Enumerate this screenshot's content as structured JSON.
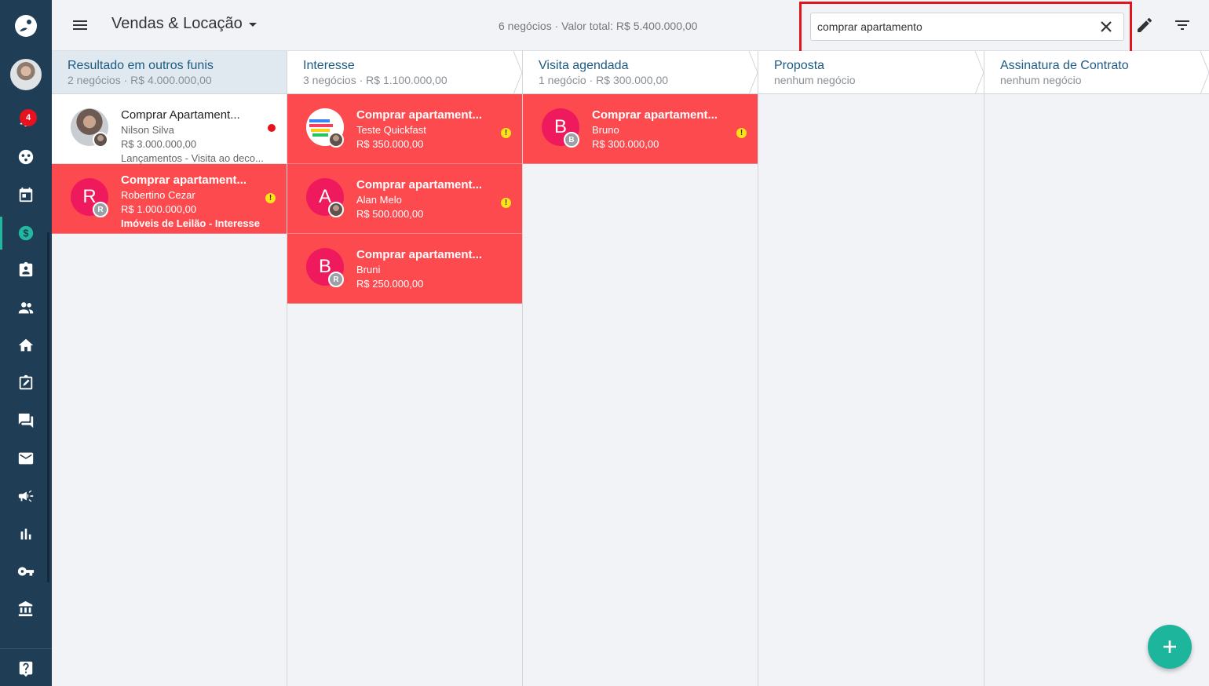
{
  "app": {
    "sidebar_badge": "4"
  },
  "header": {
    "funnel_name": "Vendas & Locação",
    "summary": "6 negócios · Valor total: R$ 5.400.000,00",
    "search_value": "comprar apartamento"
  },
  "colors": {
    "sidebar": "#1f3e55",
    "card_alert": "#fc4a4f",
    "accent": "#1db59b",
    "column_title": "#1d5a82",
    "highlight": "#e2161d"
  },
  "columns": [
    {
      "title": "Resultado em outros funis",
      "sub": "2 negócios · R$ 4.000.000,00",
      "cards": [
        {
          "title": "Comprar Apartament...",
          "person": "Nilson Silva",
          "value": "R$ 3.000.000,00",
          "extra": "Lançamentos - Visita ao deco...",
          "avatar": "",
          "style": "white"
        },
        {
          "title": "Comprar apartament...",
          "person": "Robertino Cezar",
          "value": "R$ 1.000.000,00",
          "extra": "Imóveis de Leilão - Interesse",
          "avatar": "R",
          "mini": "R",
          "style": "red"
        }
      ]
    },
    {
      "title": "Interesse",
      "sub": "3 negócios · R$ 1.100.000,00",
      "cards": [
        {
          "title": "Comprar apartament...",
          "person": "Teste Quickfast",
          "value": "R$ 350.000,00",
          "avatar": "",
          "style": "red"
        },
        {
          "title": "Comprar apartament...",
          "person": "Alan Melo",
          "value": "R$ 500.000,00",
          "avatar": "A",
          "style": "red"
        },
        {
          "title": "Comprar apartament...",
          "person": "Bruni",
          "value": "R$ 250.000,00",
          "avatar": "B",
          "mini": "R",
          "style": "red"
        }
      ]
    },
    {
      "title": "Visita agendada",
      "sub": "1 negócio · R$ 300.000,00",
      "cards": [
        {
          "title": "Comprar apartament...",
          "person": "Bruno",
          "value": "R$ 300.000,00",
          "avatar": "B",
          "mini": "B",
          "style": "red"
        }
      ]
    },
    {
      "title": "Proposta",
      "sub": "nenhum negócio",
      "cards": []
    },
    {
      "title": "Assinatura de Contrato",
      "sub": "nenhum negócio",
      "cards": []
    }
  ],
  "icons": {
    "warning": "!",
    "sidebar": [
      "app-logo-icon",
      "avatar",
      "bell-icon",
      "dashboard-icon",
      "calendar-icon",
      "dollar-icon",
      "contact-card-icon",
      "people-icon",
      "home-icon",
      "task-icon",
      "chat-icon",
      "mail-icon",
      "megaphone-icon",
      "bar-chart-icon",
      "key-icon",
      "bank-icon",
      "help-icon"
    ]
  }
}
